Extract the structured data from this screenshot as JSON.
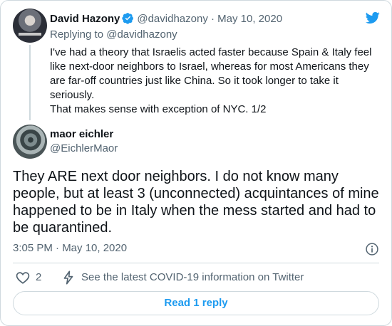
{
  "colors": {
    "accent": "#1d9bf0",
    "text": "#0f1419",
    "muted": "#536471",
    "border": "#cfd9de",
    "like_icon": "#536471"
  },
  "parent_tweet": {
    "author_name": "David Hazony",
    "verified": true,
    "handle_and_date": "@davidhazony · May 10, 2020",
    "replying_to": "Replying to @davidhazony",
    "text_line1": "I've had a theory that Israelis acted faster because Spain & Italy feel like next-door neighbors to Israel, whereas for most Americans they are far-off countries just like China. So it took longer to take it seriously.",
    "text_line2": "That makes sense with exception of NYC. 1/2"
  },
  "reply_tweet": {
    "author_name": "maor eichler",
    "handle": "@EichlerMaor",
    "text": "They ARE next door neighbors. I do not know many people, but at least 3 (unconnected) acquintances of mine happened to be in Italy when the mess started and had to be quarantined.",
    "timestamp": "3:05 PM · May 10, 2020"
  },
  "actions": {
    "like_count": "2",
    "covid_info": "See the latest COVID-19 information on Twitter"
  },
  "read_reply_label": "Read 1 reply",
  "icons": [
    "twitter-logo-icon",
    "verified-badge-icon",
    "info-icon",
    "heart-icon",
    "lightning-icon"
  ]
}
